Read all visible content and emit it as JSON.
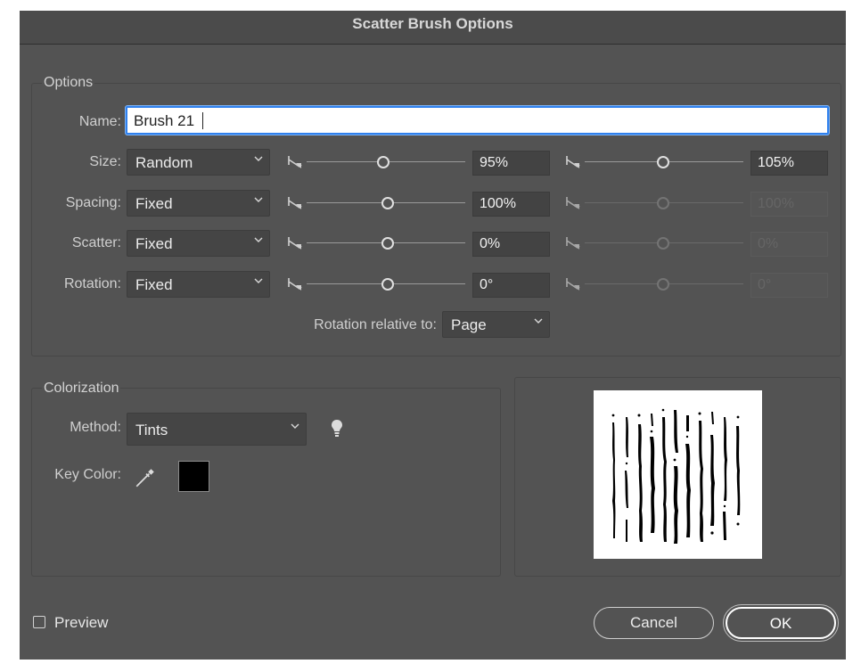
{
  "window": {
    "title": "Scatter Brush Options"
  },
  "options": {
    "legend": "Options",
    "name_label": "Name:",
    "name_value": "Brush 21",
    "rows": [
      {
        "label": "Size:",
        "method": "Random",
        "value1": "95%",
        "value2": "105%",
        "second_enabled": true
      },
      {
        "label": "Spacing:",
        "method": "Fixed",
        "value1": "100%",
        "value2": "100%",
        "second_enabled": false
      },
      {
        "label": "Scatter:",
        "method": "Fixed",
        "value1": "0%",
        "value2": "0%",
        "second_enabled": false
      },
      {
        "label": "Rotation:",
        "method": "Fixed",
        "value1": "0°",
        "value2": "0°",
        "second_enabled": false
      }
    ],
    "rotation_relative_label": "Rotation relative to:",
    "rotation_relative_value": "Page"
  },
  "colorization": {
    "legend": "Colorization",
    "method_label": "Method:",
    "method_value": "Tints",
    "key_color_label": "Key Color:",
    "key_color_hex": "#000000"
  },
  "footer": {
    "preview_label": "Preview",
    "preview_checked": false,
    "cancel_label": "Cancel",
    "ok_label": "OK"
  },
  "icons": [
    "chevron-down-icon",
    "lock-slider-icon",
    "tip-bulb-icon",
    "eyedropper-icon",
    "checkbox-icon"
  ],
  "colors": {
    "dialog_bg": "#535353",
    "accent_focus": "#2f80ed"
  }
}
